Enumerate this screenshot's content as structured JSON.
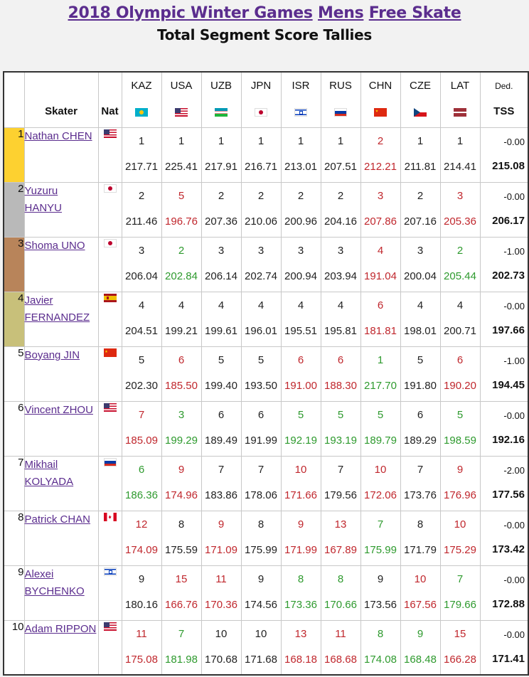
{
  "header": {
    "title_year_games": "2018 Olympic Winter Games",
    "title_event_1": "Mens",
    "title_event_2": "Free Skate",
    "subtitle": "Total Segment Score Tallies"
  },
  "columns": {
    "skater": "Skater",
    "nat": "Nat",
    "ded": "Ded.",
    "tss": "TSS",
    "judges": [
      {
        "code": "KAZ",
        "flag": "KAZ"
      },
      {
        "code": "USA",
        "flag": "USA"
      },
      {
        "code": "UZB",
        "flag": "UZB"
      },
      {
        "code": "JPN",
        "flag": "JPN"
      },
      {
        "code": "ISR",
        "flag": "ISR"
      },
      {
        "code": "RUS",
        "flag": "RUS"
      },
      {
        "code": "CHN",
        "flag": "CHN"
      },
      {
        "code": "CZE",
        "flag": "CZE"
      },
      {
        "code": "LAT",
        "flag": "LAT"
      }
    ]
  },
  "colors": {
    "gold": "#fdd130",
    "silver": "#b9b9b9",
    "bronze": "#b8845a",
    "fourth": "#c8c07a",
    "link": "#5b2d8e",
    "higher": "#2e9a2e",
    "lower": "#c0272d"
  },
  "rows": [
    {
      "rank": "1",
      "name": "Nathan CHEN",
      "nat": "USA",
      "ded": "-0.00",
      "tss": "215.08",
      "judges": [
        [
          "1",
          "217.71",
          "same"
        ],
        [
          "1",
          "225.41",
          "same"
        ],
        [
          "1",
          "217.91",
          "same"
        ],
        [
          "1",
          "216.71",
          "same"
        ],
        [
          "1",
          "213.01",
          "same"
        ],
        [
          "1",
          "207.51",
          "same"
        ],
        [
          "2",
          "212.21",
          "lower"
        ],
        [
          "1",
          "211.81",
          "same"
        ],
        [
          "1",
          "214.41",
          "same"
        ]
      ]
    },
    {
      "rank": "2",
      "name": "Yuzuru HANYU",
      "nat": "JPN",
      "ded": "-0.00",
      "tss": "206.17",
      "judges": [
        [
          "2",
          "211.46",
          "same"
        ],
        [
          "5",
          "196.76",
          "lower"
        ],
        [
          "2",
          "207.36",
          "same"
        ],
        [
          "2",
          "210.06",
          "same"
        ],
        [
          "2",
          "200.96",
          "same"
        ],
        [
          "2",
          "204.16",
          "same"
        ],
        [
          "3",
          "207.86",
          "lower"
        ],
        [
          "2",
          "207.16",
          "same"
        ],
        [
          "3",
          "205.36",
          "lower"
        ]
      ]
    },
    {
      "rank": "3",
      "name": "Shoma UNO",
      "nat": "JPN",
      "ded": "-1.00",
      "tss": "202.73",
      "judges": [
        [
          "3",
          "206.04",
          "same"
        ],
        [
          "2",
          "202.84",
          "higher"
        ],
        [
          "3",
          "206.14",
          "same"
        ],
        [
          "3",
          "202.74",
          "same"
        ],
        [
          "3",
          "200.94",
          "same"
        ],
        [
          "3",
          "203.94",
          "same"
        ],
        [
          "4",
          "191.04",
          "lower"
        ],
        [
          "3",
          "200.04",
          "same"
        ],
        [
          "2",
          "205.44",
          "higher"
        ]
      ]
    },
    {
      "rank": "4",
      "name": "Javier FERNANDEZ",
      "nat": "ESP",
      "ded": "-0.00",
      "tss": "197.66",
      "judges": [
        [
          "4",
          "204.51",
          "same"
        ],
        [
          "4",
          "199.21",
          "same"
        ],
        [
          "4",
          "199.61",
          "same"
        ],
        [
          "4",
          "196.01",
          "same"
        ],
        [
          "4",
          "195.51",
          "same"
        ],
        [
          "4",
          "195.81",
          "same"
        ],
        [
          "6",
          "181.81",
          "lower"
        ],
        [
          "4",
          "198.01",
          "same"
        ],
        [
          "4",
          "200.71",
          "same"
        ]
      ]
    },
    {
      "rank": "5",
      "name": "Boyang JIN",
      "nat": "CHN",
      "ded": "-1.00",
      "tss": "194.45",
      "judges": [
        [
          "5",
          "202.30",
          "same"
        ],
        [
          "6",
          "185.50",
          "lower"
        ],
        [
          "5",
          "199.40",
          "same"
        ],
        [
          "5",
          "193.50",
          "same"
        ],
        [
          "6",
          "191.00",
          "lower"
        ],
        [
          "6",
          "188.30",
          "lower"
        ],
        [
          "1",
          "217.70",
          "higher"
        ],
        [
          "5",
          "191.80",
          "same"
        ],
        [
          "6",
          "190.20",
          "lower"
        ]
      ]
    },
    {
      "rank": "6",
      "name": "Vincent ZHOU",
      "nat": "USA",
      "ded": "-0.00",
      "tss": "192.16",
      "judges": [
        [
          "7",
          "185.09",
          "lower"
        ],
        [
          "3",
          "199.29",
          "higher"
        ],
        [
          "6",
          "189.49",
          "same"
        ],
        [
          "6",
          "191.99",
          "same"
        ],
        [
          "5",
          "192.19",
          "higher"
        ],
        [
          "5",
          "193.19",
          "higher"
        ],
        [
          "5",
          "189.79",
          "higher"
        ],
        [
          "6",
          "189.29",
          "same"
        ],
        [
          "5",
          "198.59",
          "higher"
        ]
      ]
    },
    {
      "rank": "7",
      "name": "Mikhail KOLYADA",
      "nat": "RUS",
      "ded": "-2.00",
      "tss": "177.56",
      "judges": [
        [
          "6",
          "186.36",
          "higher"
        ],
        [
          "9",
          "174.96",
          "lower"
        ],
        [
          "7",
          "183.86",
          "same"
        ],
        [
          "7",
          "178.06",
          "same"
        ],
        [
          "10",
          "171.66",
          "lower"
        ],
        [
          "7",
          "179.56",
          "same"
        ],
        [
          "10",
          "172.06",
          "lower"
        ],
        [
          "7",
          "173.76",
          "same"
        ],
        [
          "9",
          "176.96",
          "lower"
        ]
      ]
    },
    {
      "rank": "8",
      "name": "Patrick CHAN",
      "nat": "CAN",
      "ded": "-0.00",
      "tss": "173.42",
      "judges": [
        [
          "12",
          "174.09",
          "lower"
        ],
        [
          "8",
          "175.59",
          "same"
        ],
        [
          "9",
          "171.09",
          "lower"
        ],
        [
          "8",
          "175.99",
          "same"
        ],
        [
          "9",
          "171.99",
          "lower"
        ],
        [
          "13",
          "167.89",
          "lower"
        ],
        [
          "7",
          "175.99",
          "higher"
        ],
        [
          "8",
          "171.79",
          "same"
        ],
        [
          "10",
          "175.29",
          "lower"
        ]
      ]
    },
    {
      "rank": "9",
      "name": "Alexei BYCHENKO",
      "nat": "ISR",
      "ded": "-0.00",
      "tss": "172.88",
      "judges": [
        [
          "9",
          "180.16",
          "same"
        ],
        [
          "15",
          "166.76",
          "lower"
        ],
        [
          "11",
          "170.36",
          "lower"
        ],
        [
          "9",
          "174.56",
          "same"
        ],
        [
          "8",
          "173.36",
          "higher"
        ],
        [
          "8",
          "170.66",
          "higher"
        ],
        [
          "9",
          "173.56",
          "same"
        ],
        [
          "10",
          "167.56",
          "lower"
        ],
        [
          "7",
          "179.66",
          "higher"
        ]
      ]
    },
    {
      "rank": "10",
      "name": "Adam RIPPON",
      "nat": "USA",
      "ded": "-0.00",
      "tss": "171.41",
      "judges": [
        [
          "11",
          "175.08",
          "lower"
        ],
        [
          "7",
          "181.98",
          "higher"
        ],
        [
          "10",
          "170.68",
          "same"
        ],
        [
          "10",
          "171.68",
          "same"
        ],
        [
          "13",
          "168.18",
          "lower"
        ],
        [
          "11",
          "168.68",
          "lower"
        ],
        [
          "8",
          "174.08",
          "higher"
        ],
        [
          "9",
          "168.48",
          "higher"
        ],
        [
          "15",
          "166.28",
          "lower"
        ]
      ]
    }
  ]
}
